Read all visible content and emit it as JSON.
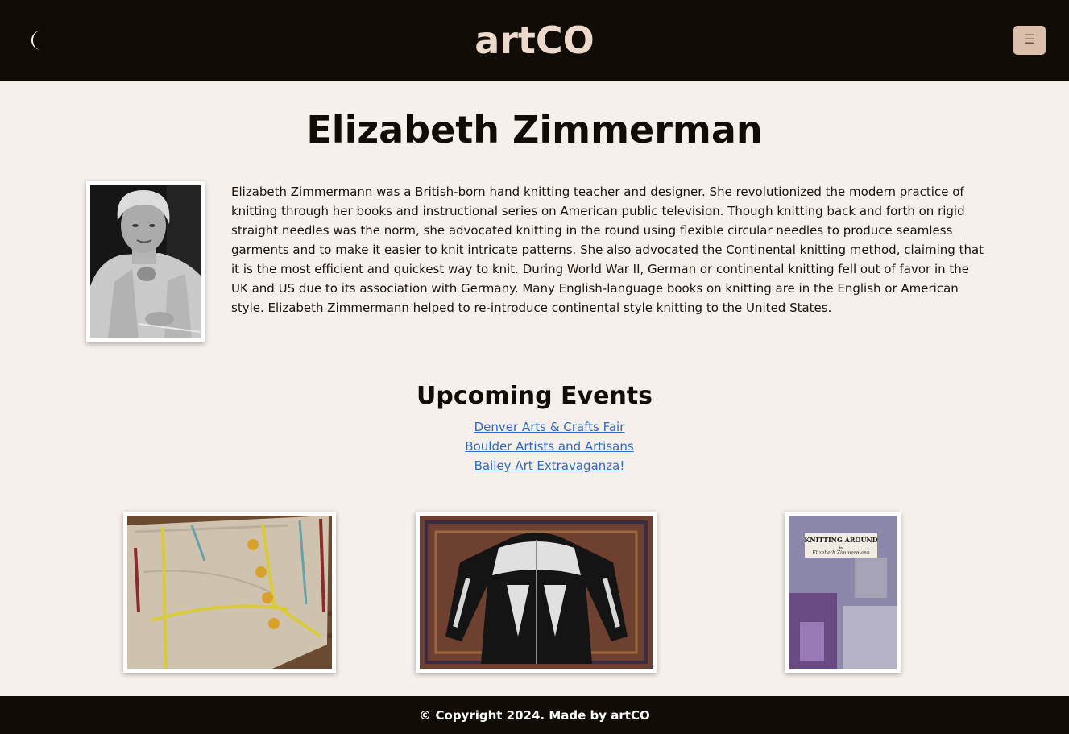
{
  "header": {
    "brand": "artCO",
    "theme_toggle_icon": "crescent-moon-icon",
    "menu_icon": "hamburger-menu-icon"
  },
  "main": {
    "title": "Elizabeth Zimmerman",
    "bio": "Elizabeth Zimmermann was a British-born hand knitting teacher and designer. She revolutionized the modern practice of knitting through her books and instructional series on American public television. Though knitting back and forth on rigid straight needles was the norm, she advocated knitting in the round using flexible circular needles to produce seamless garments and to make it easier to knit intricate patterns. She also advocated the Continental knitting method, claiming that it is the most efficient and quickest way to knit. During World War II, German or continental knitting fell out of favor in the UK and US due to its association with Germany. Many English-language books on knitting are in the English or American style. Elizabeth Zimmermann helped to re-introduce continental style knitting to the United States.",
    "events_title": "Upcoming Events",
    "events": [
      "Denver Arts & Crafts Fair",
      "Boulder Artists and Artisans",
      "Bailey Art Extravaganza!"
    ],
    "book_cover": {
      "title": "KNITTING AROUND",
      "by": "by",
      "author": "Elizabeth Zimmermann"
    }
  },
  "footer": {
    "text": "© Copyright 2024. Made by artCO"
  },
  "colors": {
    "header_bg": "#120c07",
    "page_bg": "#f6f0ec",
    "brand": "#ecd9cc",
    "menu_button": "#dcbfab",
    "link": "#2f6bc8"
  }
}
